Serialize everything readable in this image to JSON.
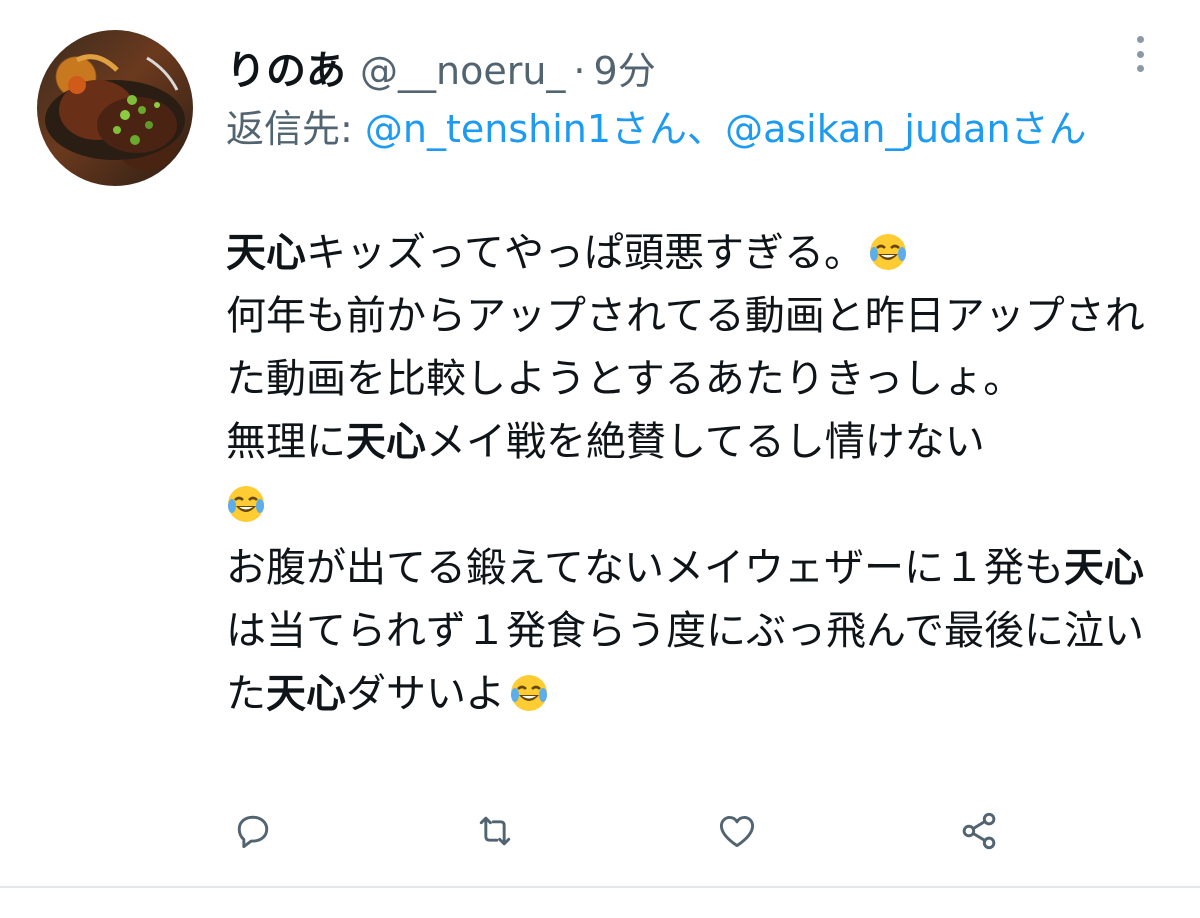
{
  "tweet": {
    "display_name": "りのあ",
    "handle": "@__noeru_",
    "separator": "·",
    "time": "9分",
    "reply_prefix": "返信先: ",
    "reply_mention_1": "@n_tenshin1さん",
    "reply_joiner": "、",
    "reply_mention_2": "@asikan_judanさん",
    "body": {
      "l1_hl": "天心",
      "l1_rest": "キッズってやっぱ頭悪すぎる。",
      "l2": "何年も前からアップされてる動画と昨日アップされた動画を比較しようとするあたりきっしょ。",
      "l3_pre": "無理に",
      "l3_hl": "天心",
      "l3_rest": "メイ戦を絶賛してるし情けない",
      "l4": "お腹が出てる鍛えてないメイウェザーに１発も",
      "l4_hl": "天心",
      "l4_rest": "は当てられず１発食らう度にぶっ飛んで最後に泣いた",
      "l4_hl2": "天心",
      "l4_end": "ダサいよ"
    },
    "emoji": "face-with-tears-of-joy"
  },
  "actions": {
    "reply_icon": "reply-icon",
    "retweet_icon": "retweet-icon",
    "like_icon": "like-icon",
    "share_icon": "share-icon"
  },
  "colors": {
    "text": "#0f1419",
    "secondary": "#536471",
    "link": "#1d9bf0",
    "icon": "#536471"
  }
}
